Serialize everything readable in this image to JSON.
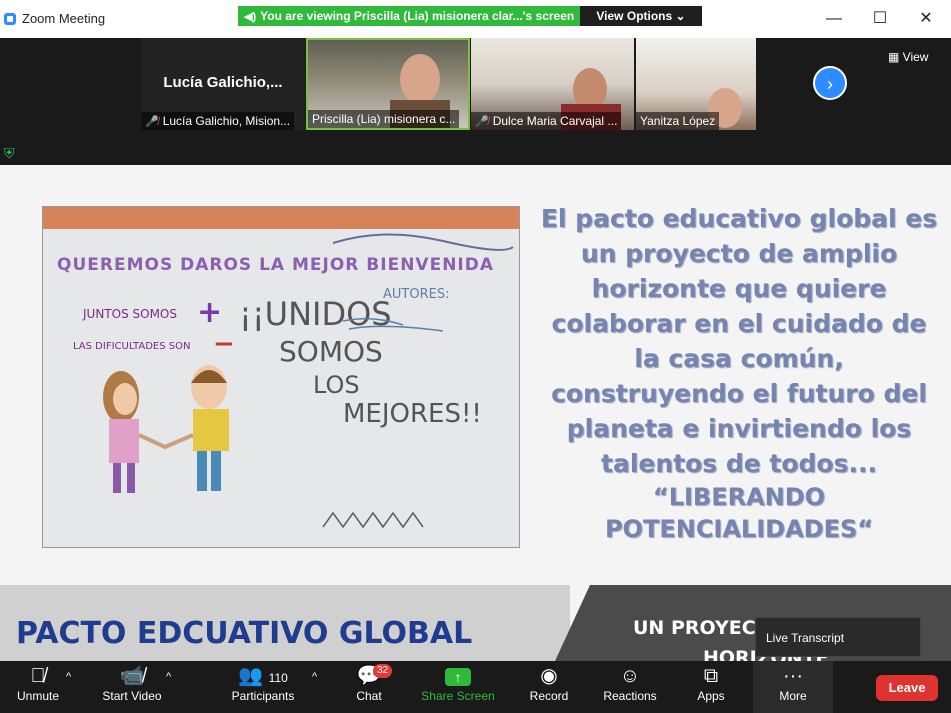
{
  "window": {
    "title": "Zoom Meeting",
    "banner": "You are viewing Priscilla (Lia) misionera clar...'s screen",
    "view_options": "View Options",
    "controls": {
      "minimize": "—",
      "maximize": "☐",
      "close": "✕"
    }
  },
  "gallery": {
    "big_name": "Lucía  Galichio,...",
    "tiles": [
      {
        "name": "Lucía Galichio, Mision...",
        "muted": true
      },
      {
        "name": "Priscilla (Lia) misionera c...",
        "muted": false
      },
      {
        "name": "Dulce Maria Carvajal ...",
        "muted": true
      },
      {
        "name": "Yanitza López",
        "muted": false
      }
    ],
    "view_label": "View"
  },
  "slide": {
    "drawing": {
      "header": "QUEREMOS DAROS LA MEJOR BIENVENIDA",
      "line1": "JUNTOS SOMOS",
      "line2": "LAS DIFICULTADES SON",
      "plus": "+",
      "minus": "−",
      "unidos1": "¡¡UNIDOS",
      "unidos2": "SOMOS",
      "unidos3": "LOS",
      "unidos4": "MEJORES!!",
      "autores": "AUTORES:"
    },
    "paragraph": "El  pacto educativo global es un proyecto de amplio horizonte que quiere colaborar en el cuidado de la casa común, construyendo el futuro del planeta e invirtiendo los talentos de todos...",
    "quote": "“LIBERANDO POTENCIALIDADES“",
    "footer_title": "PACTO EDCUATIVO GLOBAL",
    "footer_subtitle": "UN PROYECT",
    "footer_subtitle2": "HORIZONTE"
  },
  "live_transcript": "Live Transcript",
  "toolbar": {
    "unmute": "Unmute",
    "start_video": "Start Video",
    "participants": "Participants",
    "participants_count": "110",
    "chat": "Chat",
    "chat_badge": "32",
    "share_screen": "Share Screen",
    "record": "Record",
    "reactions": "Reactions",
    "apps": "Apps",
    "more": "More",
    "leave": "Leave"
  },
  "colors": {
    "accent": "#2d8cff",
    "share_green": "#2fba3c",
    "leave_red": "#e0322e",
    "slide_text": "#7585b0",
    "footer_title": "#1f3c8f"
  }
}
